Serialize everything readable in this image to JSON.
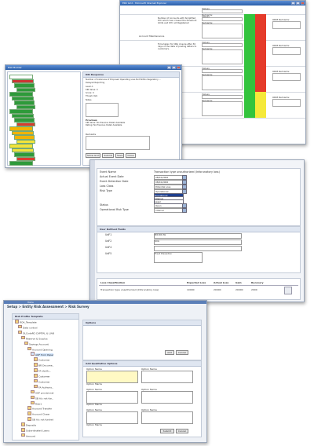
{
  "win1": {
    "title": "ERC Grid - Microsoft Internet Explorer",
    "category": "Account Maintenance",
    "rows": [
      {
        "label": "Values",
        "desc": "",
        "remarks": "Remarks:",
        "status": "white",
        "orm": ""
      },
      {
        "label": "Values",
        "desc": "Number of Accounts with Simplified KYC which has crossed the threshold limits and KYC not Registered",
        "remarks": "Remarks:",
        "status": "green-red",
        "orm": "ORM Remarks:"
      },
      {
        "label": "Values",
        "desc": "Time taken for ORA closure after 30 days of the date of posting letters to customers.",
        "remarks": "Remarks:",
        "status": "green-red",
        "orm": "ORM Remarks:"
      },
      {
        "label": "Values",
        "desc": "",
        "remarks": "Remarks:",
        "status": "green-red",
        "orm": "ORM Remarks:"
      },
      {
        "label": "Values",
        "desc": "",
        "remarks": "Remarks:",
        "status": "green-yellow",
        "orm": "ORM Remarks:"
      }
    ]
  },
  "win2": {
    "tree_title": "Risk Builder",
    "form_title": "KRI Response",
    "form_lines": [
      "Number of Instances of Proposed Operating Loss Not Within Regulatory ...",
      "Delayed Reporting",
      "Level A",
      "KRI Value: 0",
      "Score: 0",
      "Thresh: N/A",
      "Notes"
    ],
    "previous": "Previous",
    "previous_lines": [
      "KRI Value: No Previous Detail Available",
      "Rating: No Previous Detail Available"
    ],
    "remarks": "Remarks",
    "buttons": [
      "Show Grid",
      "Submit",
      "Save",
      "Close"
    ]
  },
  "win3": {
    "event_name_label": "Event Name",
    "event_name_value": "Transaction type unauthorized (Inforunatory loss)",
    "fields": [
      {
        "label": "Actual Event Date",
        "value": "08/04/2006"
      },
      {
        "label": "Event Detection Date",
        "value": "08/04/2006"
      },
      {
        "label": "Loss Class",
        "value": "Potential Loss"
      },
      {
        "label": "Risk Type",
        "value": "Operational"
      },
      {
        "label": "Status",
        "value": "Open"
      },
      {
        "label": "Operational Risk Type",
        "value": "Internal"
      }
    ],
    "risk_options": [
      "Operational",
      "Internal",
      "Legal"
    ],
    "udf_header": "User Defined Fields",
    "udf": [
      {
        "label": "UdF1",
        "value": "MW  RW  IW"
      },
      {
        "label": "UdF2",
        "value": "SOG"
      },
      {
        "label": "UdF4",
        "value": ""
      },
      {
        "label": "UdF5",
        "value": "Fraud Prevention"
      }
    ],
    "loss_header": [
      "Loss Classification",
      "Expected Loss",
      "Actual Loss",
      "Gain",
      "Recovery"
    ],
    "loss_row": [
      "Transaction type unauthorized (Inforunatory loss)",
      "10000",
      "20000",
      "20000",
      "2000"
    ]
  },
  "win4": {
    "breadcrumb": "Setup > Entity Risk Assessment > Risk Survey",
    "top_tab": "Home",
    "tree_title": "Risk Profile Template",
    "tree": [
      "ROA_Template",
      "Data control",
      "OLCodeRC-CAPITAL & LIAB",
      "Reserve & Surplus",
      "Savings Account",
      "Account Opening",
      "AOF from Paper",
      "Customer",
      "BR Docume..",
      "FA Verific..",
      "Customer",
      "Customer",
      "FA Authoris..",
      "AOF provisional",
      "SB A/c not fun..",
      "Risk1",
      "Account Transfer",
      "Account Closer",
      "SB A/c not funded",
      "Deposits",
      "Subordinated Loans",
      "Amount"
    ],
    "options_title": "Options",
    "qual_title": "Add Qualitative Options",
    "option_label": "Option Name",
    "marks_label": "Option Marks",
    "buttons": [
      "Add",
      "Cancel",
      "Submit",
      "Cancel"
    ]
  },
  "colors": {
    "titlebar": "#2a5ea8",
    "green": "#33c43d",
    "red": "#e53b2a",
    "yellow": "#f5e93a",
    "treeSel": "#d93b2f"
  }
}
